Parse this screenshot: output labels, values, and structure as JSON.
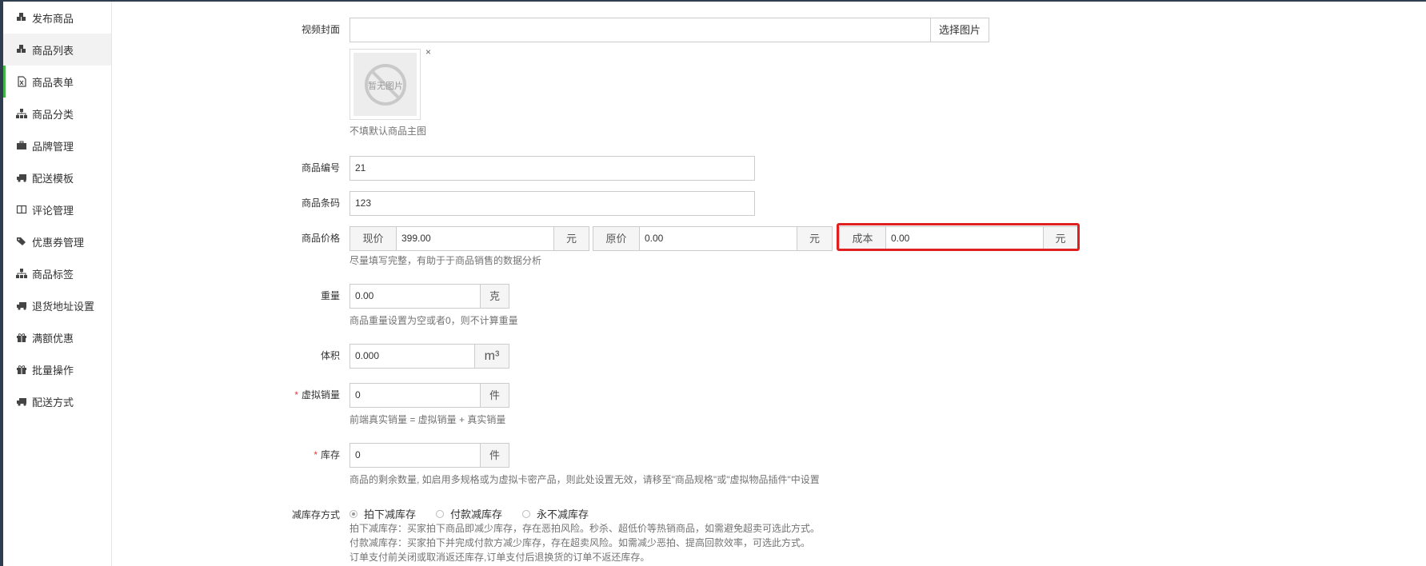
{
  "sidebar": {
    "items": [
      {
        "label": "发布商品",
        "icon": "cubes-icon"
      },
      {
        "label": "商品列表",
        "icon": "cubes-icon"
      },
      {
        "label": "商品表单",
        "icon": "file-excel-icon"
      },
      {
        "label": "商品分类",
        "icon": "sitemap-icon"
      },
      {
        "label": "品牌管理",
        "icon": "briefcase-icon"
      },
      {
        "label": "配送模板",
        "icon": "truck-icon"
      },
      {
        "label": "评论管理",
        "icon": "columns-icon"
      },
      {
        "label": "优惠券管理",
        "icon": "tags-icon"
      },
      {
        "label": "商品标签",
        "icon": "sitemap-icon"
      },
      {
        "label": "退货地址设置",
        "icon": "truck-icon"
      },
      {
        "label": "满额优惠",
        "icon": "gift-icon"
      },
      {
        "label": "批量操作",
        "icon": "gift-icon"
      },
      {
        "label": "配送方式",
        "icon": "truck-icon"
      }
    ]
  },
  "form": {
    "video_cover": {
      "label": "视频封面",
      "value": "",
      "button": "选择图片",
      "thumb_text": "暂无图片",
      "remove": "×",
      "help": "不填默认商品主图"
    },
    "goods_sn": {
      "label": "商品编号",
      "value": "21"
    },
    "barcode": {
      "label": "商品条码",
      "value": "123"
    },
    "price": {
      "label": "商品价格",
      "current_label": "现价",
      "current_value": "399.00",
      "original_label": "原价",
      "original_value": "0.00",
      "cost_label": "成本",
      "cost_value": "0.00",
      "unit": "元",
      "help": "尽量填写完整，有助于于商品销售的数据分析"
    },
    "weight": {
      "label": "重量",
      "value": "0.00",
      "unit": "克",
      "help": "商品重量设置为空或者0，则不计算重量"
    },
    "volume": {
      "label": "体积",
      "value": "0.000",
      "unit": "m³"
    },
    "virtual_sales": {
      "required": "*",
      "label": "虚拟销量",
      "value": "0",
      "unit": "件",
      "help": "前端真实销量 = 虚拟销量 + 真实销量"
    },
    "stock": {
      "required": "*",
      "label": "库存",
      "value": "0",
      "unit": "件",
      "help": "商品的剩余数量, 如启用多规格或为虚拟卡密产品，则此处设置无效，请移至\"商品规格\"或\"虚拟物品插件\"中设置"
    },
    "reduce_stock": {
      "label": "减库存方式",
      "options": [
        "拍下减库存",
        "付款减库存",
        "永不减库存"
      ],
      "selected": "拍下减库存",
      "help1": "拍下减库存：买家拍下商品即减少库存，存在恶拍风险。秒杀、超低价等热销商品，如需避免超卖可选此方式。",
      "help2": "付款减库存：买家拍下并完成付款方减少库存，存在超卖风险。如需减少恶拍、提高回款效率，可选此方式。",
      "help3": "订单支付前关闭或取消返还库存,订单支付后退换货的订单不返还库存。"
    }
  },
  "colors": {
    "highlight": "#e02020",
    "required": "#e4393c",
    "active_bar": "#44b549"
  }
}
